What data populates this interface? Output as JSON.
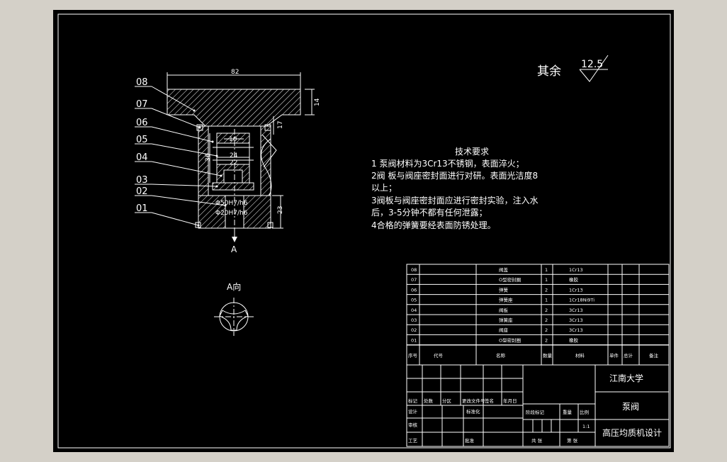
{
  "surface_finish": {
    "label": "其余",
    "value": "12.5"
  },
  "part_labels": [
    "08",
    "07",
    "06",
    "05",
    "04",
    "03",
    "02",
    "01"
  ],
  "dimensions": {
    "d82": "82",
    "d14": "14",
    "d17": "17",
    "d36": "36",
    "d10": "10",
    "d24": "24",
    "d22": "22",
    "d23": "23",
    "fit1": "Φ50H7/h6",
    "fit2": "Φ20H7/h6"
  },
  "section_mark": "A",
  "view_label": "A向",
  "tech_requirements": {
    "title": "技术要求",
    "lines": [
      "1  泵阀材料为3Cr13不锈钢，表面淬火；",
      "2阀 板与阀座密封面进行对研。表面光洁度8",
      "以上；",
      "3阀板与阀座密封面应进行密封实验，注入水",
      "后，3-5分钟不都有任何泄露；",
      "4合格的弹簧要经表面防锈处理。"
    ]
  },
  "bom": {
    "rows": [
      {
        "no": "08",
        "name": "阀盖",
        "qty": "1",
        "material": "1Cr13"
      },
      {
        "no": "07",
        "name": "O型密封圈",
        "qty": "1",
        "material": "橡胶"
      },
      {
        "no": "06",
        "name": "弹簧",
        "qty": "2",
        "material": "1Cr13"
      },
      {
        "no": "05",
        "name": "弹簧座",
        "qty": "1",
        "material": "1Cr18Ni9Ti"
      },
      {
        "no": "04",
        "name": "阀板",
        "qty": "2",
        "material": "3Cr13"
      },
      {
        "no": "03",
        "name": "弹簧座",
        "qty": "2",
        "material": "3Cr13"
      },
      {
        "no": "02",
        "name": "阀座",
        "qty": "2",
        "material": "3Cr13"
      },
      {
        "no": "01",
        "name": "O型密封圈",
        "qty": "2",
        "material": "橡胶"
      }
    ],
    "header": {
      "no": "序号",
      "code": "代号",
      "name": "名称",
      "qty": "数量",
      "material": "材料",
      "unit_weight": "单件",
      "total_weight": "总计",
      "weight": "重量",
      "remark": "备注"
    }
  },
  "title_block": {
    "school": "江南大学",
    "drawing_name": "泵阀",
    "project": "高压均质机设计",
    "labels": {
      "mark": "标记",
      "count": "处数",
      "zone": "分区",
      "change_no": "更改文件号",
      "sign": "签名",
      "date": "年月日",
      "designer": "设计",
      "standardize": "标准化",
      "stage_mark": "阶段标记",
      "weight": "重量",
      "scale": "比例",
      "review": "审核",
      "process": "工艺",
      "approve": "批准",
      "sheet_total": "共 张",
      "sheet_no": "第 张"
    },
    "scale_value": "1:1"
  }
}
